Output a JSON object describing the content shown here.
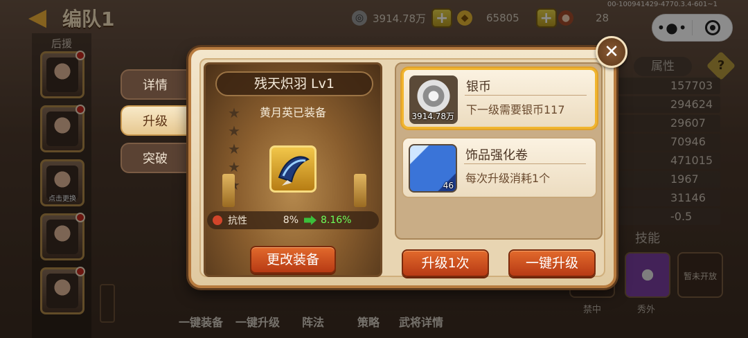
{
  "header": {
    "title": "编队1",
    "version": "00-100941429-4770.3.4-601~1",
    "resources": [
      {
        "icon": "silver-coin-icon",
        "value": "3914.78万"
      },
      {
        "icon": "gold-ingot-icon",
        "value": "65805"
      },
      {
        "icon": "meat-icon",
        "value": "28"
      }
    ]
  },
  "hero_list": {
    "label": "后援",
    "badge_text": "点击更换"
  },
  "bottom_nav": [
    "一键装备",
    "一键升级",
    "阵法",
    "策略",
    "武将详情"
  ],
  "attributes": {
    "header": "属性",
    "help": "?",
    "values": [
      "157703",
      "294624",
      "29607",
      "70946",
      "471015",
      "1967",
      "31146",
      "-0.5"
    ],
    "skill_header": "技能",
    "skill_locked": "暂未开放",
    "skill_labels": [
      "禁中",
      "秀外"
    ]
  },
  "modal": {
    "tabs": [
      {
        "label": "详情",
        "active": false
      },
      {
        "label": "升级",
        "active": true
      },
      {
        "label": "突破",
        "active": false
      }
    ],
    "item": {
      "name": "残天炽羽  Lv1",
      "equipped_by": "黄月英已装备",
      "stars": 5,
      "stat_name": "抗性",
      "stat_current": "8%",
      "stat_next": "8.16%",
      "change_button": "更改装备"
    },
    "materials": [
      {
        "icon": "silver-coin-icon",
        "title": "银币",
        "desc": "下一级需要银币117",
        "qty": "3914.78万",
        "selected": true
      },
      {
        "icon": "accessory-scroll-icon",
        "title": "饰品强化卷",
        "desc": "每次升级消耗1个",
        "qty": "46",
        "selected": false
      }
    ],
    "upgrade_once": "升级1次",
    "upgrade_all": "一键升级",
    "close": "✕"
  },
  "colors": {
    "accent_gold": "#f1b52e",
    "button_red": "#c8481c",
    "stat_green": "#6dff5a"
  }
}
